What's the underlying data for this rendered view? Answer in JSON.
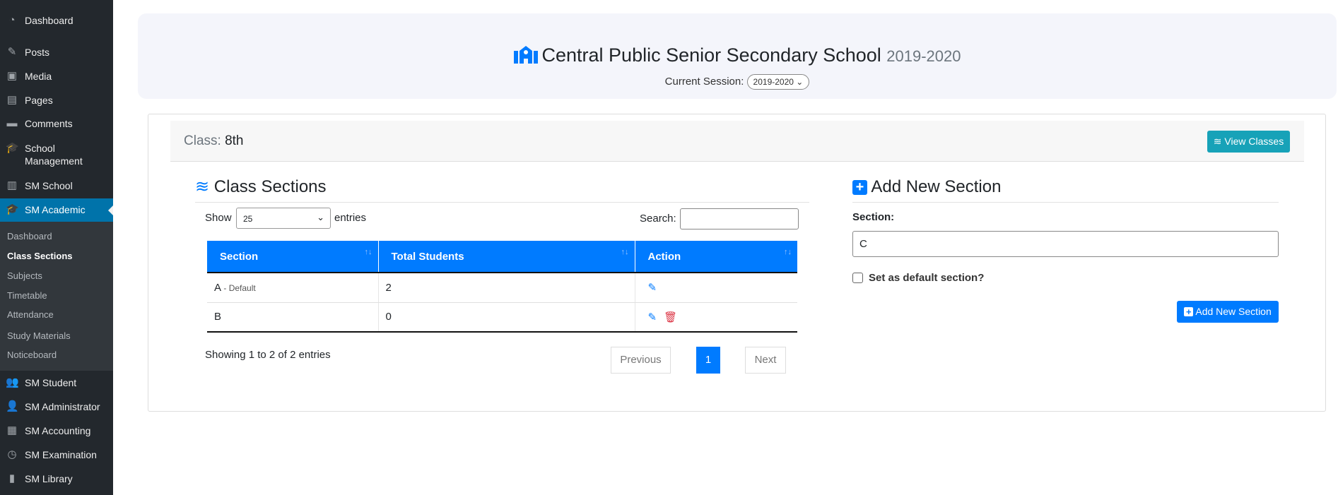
{
  "sidebar": {
    "items": [
      "Dashboard",
      "Posts",
      "Media",
      "Pages",
      "Comments",
      "School Management",
      "SM School",
      "SM Academic",
      "SM Student",
      "SM Administrator",
      "SM Accounting",
      "SM Examination",
      "SM Library"
    ],
    "submenu": [
      "Dashboard",
      "Class Sections",
      "Subjects",
      "Timetable",
      "Attendance",
      "Study Materials",
      "Noticeboard"
    ]
  },
  "header": {
    "school": "Central Public Senior Secondary School",
    "year": "2019-2020",
    "session_label": "Current Session:",
    "session_value": "2019-2020"
  },
  "card": {
    "class_label": "Class:",
    "class_value": "8th",
    "view_classes": "View Classes"
  },
  "sections": {
    "title": "Class Sections",
    "show": "Show",
    "length": "25",
    "entries": "entries",
    "search": "Search:",
    "columns": [
      "Section",
      "Total Students",
      "Action"
    ],
    "rows": [
      {
        "section": "A",
        "tag": "- Default",
        "total": "2"
      },
      {
        "section": "B",
        "tag": "",
        "total": "0"
      }
    ],
    "info": "Showing 1 to 2 of 2 entries",
    "prev": "Previous",
    "page": "1",
    "next": "Next"
  },
  "add": {
    "title": "Add New Section",
    "label": "Section:",
    "value": "C",
    "checkbox": "Set as default section?",
    "button": "Add New Section"
  },
  "colors": {
    "primary": "#007bff",
    "info": "#17a2b8",
    "danger": "#dc3545",
    "sidebar": "#23282d",
    "active": "#0073aa"
  }
}
